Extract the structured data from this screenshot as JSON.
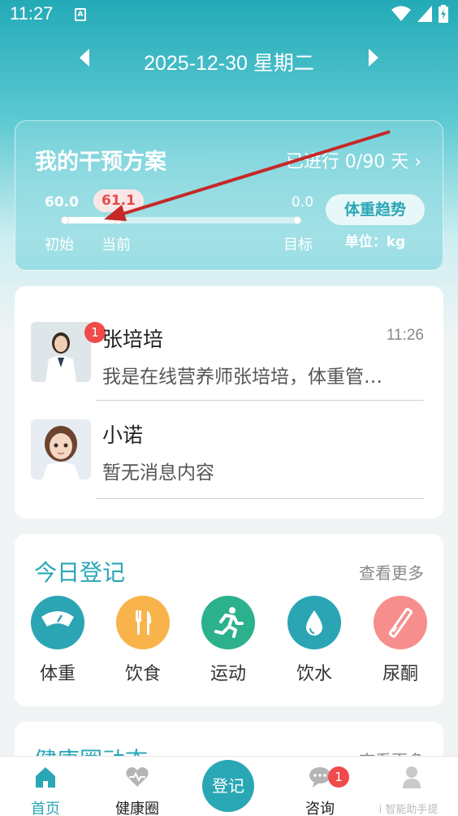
{
  "status_bar": {
    "time": "11:27",
    "notif_icon": "A"
  },
  "date_nav": {
    "date": "2025-12-30 星期二",
    "prev_icon": "chevron-left",
    "next_icon": "chevron-right"
  },
  "plan": {
    "title": "我的干预方案",
    "progress": "已进行 0/90 天 ›",
    "start_weight": "60.0",
    "current_weight": "61.1",
    "target_weight": "0.0",
    "start_label": "初始",
    "current_label": "当前",
    "target_label": "目标",
    "trend_button": "体重趋势",
    "unit": "单位：kg",
    "slider_current_fraction": 0.24
  },
  "messages": [
    {
      "name": "张培培",
      "time": "11:26",
      "text": "我是在线营养师张培培，体重管…",
      "unread": "1"
    },
    {
      "name": "小诺",
      "time": "",
      "text": "暂无消息内容",
      "unread": ""
    }
  ],
  "today": {
    "title": "今日登记",
    "more": "查看更多",
    "items": [
      {
        "label": "体重",
        "icon": "scale-icon",
        "color": "#2ba5b3"
      },
      {
        "label": "饮食",
        "icon": "fork-knife-icon",
        "color": "#f9b34b"
      },
      {
        "label": "运动",
        "icon": "running-icon",
        "color": "#2bb18c"
      },
      {
        "label": "饮水",
        "icon": "water-drop-icon",
        "color": "#2ba5b3"
      },
      {
        "label": "尿酮",
        "icon": "test-strip-icon",
        "color": "#f78e8e"
      }
    ]
  },
  "circle": {
    "title": "健康圈动态",
    "more": "查看更多"
  },
  "bottom_nav": {
    "home": "首页",
    "circle": "健康圈",
    "register": "登记",
    "consult": "咨询",
    "consult_badge": "1",
    "watermark": "i 智能助手提醒你"
  },
  "colors": {
    "accent": "#2aa7b5",
    "badge": "#f04a4a",
    "annotation_arrow": "#c62828"
  }
}
